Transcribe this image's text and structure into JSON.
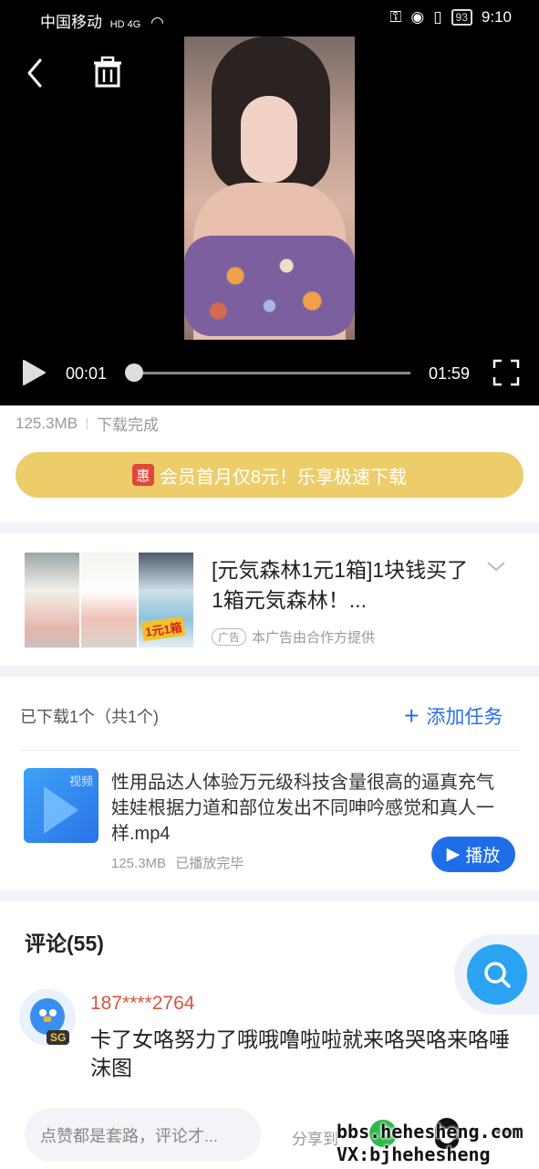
{
  "status_bar": {
    "carrier": "中国移动",
    "network": "HD 4G",
    "battery": "93",
    "time": "9:10"
  },
  "player": {
    "current_time": "00:01",
    "total_time": "01:59",
    "progress_fraction": 0.01
  },
  "file_info": {
    "size": "125.3MB",
    "status": "下载完成"
  },
  "vip_banner": {
    "badge": "惠",
    "text": "会员首月仅8元！乐享极速下载"
  },
  "ad": {
    "title": "[元気森林1元1箱]1块钱买了1箱元気森林！...",
    "thumb_badge": "1元1箱",
    "tag": "广告",
    "provider": "本广告由合作方提供"
  },
  "downloads": {
    "header": "已下载1个（共1个)",
    "add_task": "添加任务",
    "item": {
      "icon_label": "视频",
      "name": "性用品达人体验万元级科技含量很高的逼真充气娃娃根据力道和部位发出不同呻吟感觉和真人一样.mp4",
      "size": "125.3MB",
      "status": "已播放完毕",
      "play_label": "播放"
    }
  },
  "comments": {
    "title": "评论(55)",
    "items": [
      {
        "user": "187****2764",
        "badge": "SG",
        "text": "卡了女咯努力了哦哦噜啦啦就来咯哭咯来咯唾沫图"
      }
    ]
  },
  "bottom_bar": {
    "input_placeholder": "点赞都是套路，评论才...",
    "share_label": "分享到"
  },
  "watermark": {
    "line1": "bbs.hehesheng.com",
    "line2": "VX:bjhehesheng"
  },
  "colors": {
    "accent_blue": "#1f6ee8",
    "vip_gold": "#eccd6a",
    "username_red": "#d9543f"
  }
}
